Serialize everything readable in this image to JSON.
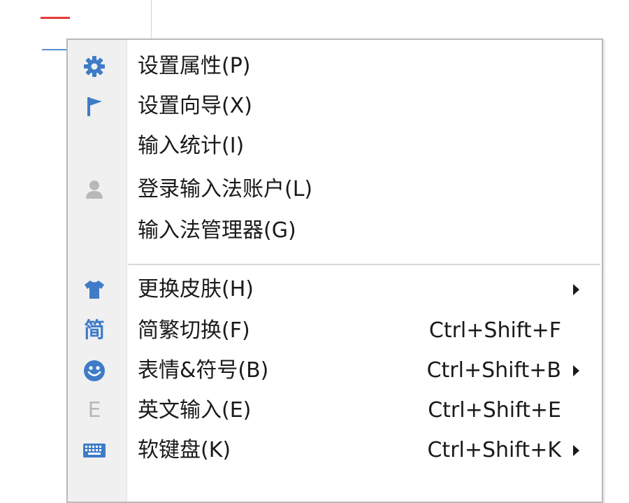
{
  "colors": {
    "icon_blue": "#3f7cc7",
    "icon_grey": "#b8b8b8",
    "separator": "#d9d9d9",
    "gutter": "#f0f0f0"
  },
  "menu": {
    "items": [
      {
        "label": "设置属性(P)",
        "icon": "gear-icon"
      },
      {
        "label": "设置向导(X)",
        "icon": "flag-icon"
      },
      {
        "label": "输入统计(I)",
        "icon": ""
      },
      {
        "label": "登录输入法账户(L)",
        "icon": "user-icon"
      },
      {
        "label": "输入法管理器(G)",
        "icon": ""
      },
      {
        "label": "更换皮肤(H)",
        "icon": "shirt-icon",
        "submenu": true
      },
      {
        "label": "简繁切换(F)",
        "icon": "simplified-char-icon",
        "icon_text": "简",
        "shortcut": "Ctrl+Shift+F"
      },
      {
        "label": "表情&符号(B)",
        "icon": "smiley-icon",
        "shortcut": "Ctrl+Shift+B",
        "submenu": true
      },
      {
        "label": "英文输入(E)",
        "icon": "letter-e-icon",
        "icon_text": "E",
        "shortcut": "Ctrl+Shift+E"
      },
      {
        "label": "软键盘(K)",
        "icon": "keyboard-icon",
        "shortcut": "Ctrl+Shift+K",
        "submenu": true
      }
    ]
  }
}
